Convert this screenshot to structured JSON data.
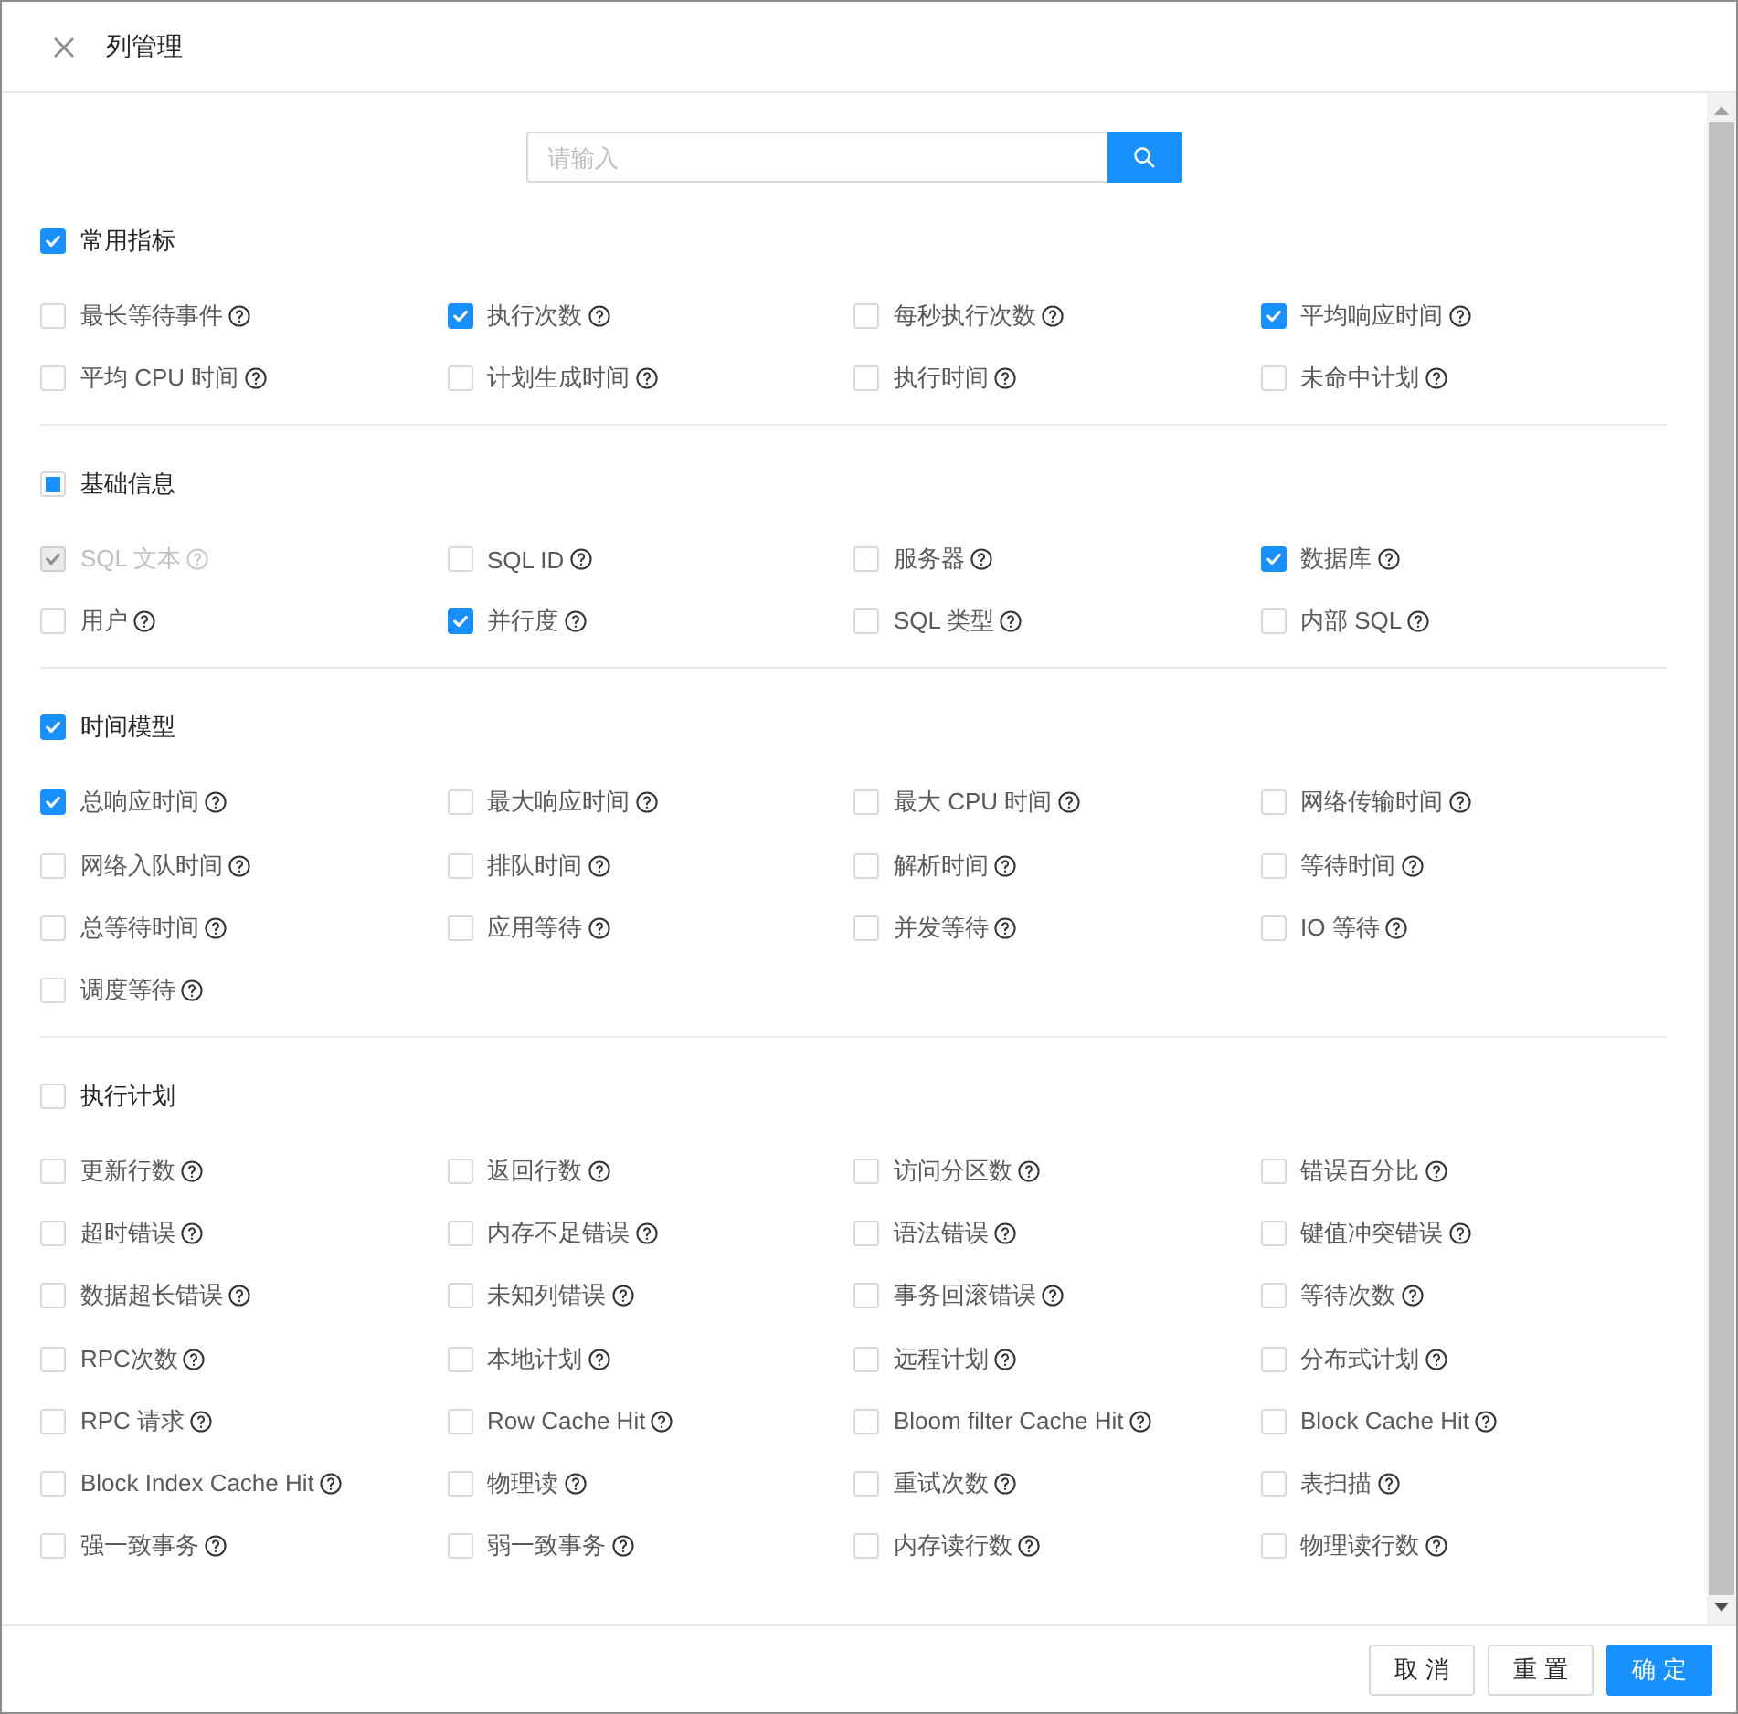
{
  "dialog": {
    "title": "列管理"
  },
  "search": {
    "placeholder": "请输入"
  },
  "groups": [
    {
      "label": "常用指标",
      "checked": true,
      "indeterminate": false,
      "items": [
        {
          "label": "最长等待事件",
          "checked": false
        },
        {
          "label": "执行次数",
          "checked": true
        },
        {
          "label": "每秒执行次数",
          "checked": false
        },
        {
          "label": "平均响应时间",
          "checked": true
        },
        {
          "label": "平均 CPU 时间",
          "checked": false
        },
        {
          "label": "计划生成时间",
          "checked": false
        },
        {
          "label": "执行时间",
          "checked": false
        },
        {
          "label": "未命中计划",
          "checked": false
        }
      ]
    },
    {
      "label": "基础信息",
      "checked": false,
      "indeterminate": true,
      "items": [
        {
          "label": "SQL 文本",
          "checked": true,
          "disabled": true
        },
        {
          "label": "SQL ID",
          "checked": false,
          "disabled": false
        },
        {
          "label": "服务器",
          "checked": false,
          "disabled": false
        },
        {
          "label": "数据库",
          "checked": true,
          "disabled": false
        },
        {
          "label": "用户",
          "checked": false,
          "disabled": false
        },
        {
          "label": "并行度",
          "checked": true,
          "disabled": false
        },
        {
          "label": "SQL 类型",
          "checked": false,
          "disabled": false
        },
        {
          "label": "内部 SQL",
          "checked": false,
          "disabled": false
        }
      ]
    },
    {
      "label": "时间模型",
      "checked": true,
      "indeterminate": false,
      "items": [
        {
          "label": "总响应时间",
          "checked": true
        },
        {
          "label": "最大响应时间",
          "checked": false
        },
        {
          "label": "最大 CPU 时间",
          "checked": false
        },
        {
          "label": "网络传输时间",
          "checked": false
        },
        {
          "label": "网络入队时间",
          "checked": false
        },
        {
          "label": "排队时间",
          "checked": false
        },
        {
          "label": "解析时间",
          "checked": false
        },
        {
          "label": "等待时间",
          "checked": false
        },
        {
          "label": "总等待时间",
          "checked": false
        },
        {
          "label": "应用等待",
          "checked": false
        },
        {
          "label": "并发等待",
          "checked": false
        },
        {
          "label": "IO 等待",
          "checked": false
        },
        {
          "label": "调度等待",
          "checked": false
        }
      ]
    },
    {
      "label": "执行计划",
      "checked": false,
      "indeterminate": false,
      "items": [
        {
          "label": "更新行数",
          "checked": false
        },
        {
          "label": "返回行数",
          "checked": false
        },
        {
          "label": "访问分区数",
          "checked": false
        },
        {
          "label": "错误百分比",
          "checked": false
        },
        {
          "label": "超时错误",
          "checked": false
        },
        {
          "label": "内存不足错误",
          "checked": false
        },
        {
          "label": "语法错误",
          "checked": false
        },
        {
          "label": "键值冲突错误",
          "checked": false
        },
        {
          "label": "数据超长错误",
          "checked": false
        },
        {
          "label": "未知列错误",
          "checked": false
        },
        {
          "label": "事务回滚错误",
          "checked": false
        },
        {
          "label": "等待次数",
          "checked": false
        },
        {
          "label": "RPC次数",
          "checked": false
        },
        {
          "label": "本地计划",
          "checked": false
        },
        {
          "label": "远程计划",
          "checked": false
        },
        {
          "label": "分布式计划",
          "checked": false
        },
        {
          "label": "RPC 请求",
          "checked": false
        },
        {
          "label": "Row Cache Hit",
          "checked": false
        },
        {
          "label": "Bloom filter Cache Hit",
          "checked": false
        },
        {
          "label": "Block Cache Hit",
          "checked": false
        },
        {
          "label": "Block Index Cache Hit",
          "checked": false
        },
        {
          "label": "物理读",
          "checked": false
        },
        {
          "label": "重试次数",
          "checked": false
        },
        {
          "label": "表扫描",
          "checked": false
        },
        {
          "label": "强一致事务",
          "checked": false
        },
        {
          "label": "弱一致事务",
          "checked": false
        },
        {
          "label": "内存读行数",
          "checked": false
        },
        {
          "label": "物理读行数",
          "checked": false
        }
      ]
    }
  ],
  "buttons": [
    {
      "label": "取消",
      "kind": "default"
    },
    {
      "label": "重置",
      "kind": "default"
    },
    {
      "label": "确定",
      "kind": "primary"
    }
  ]
}
